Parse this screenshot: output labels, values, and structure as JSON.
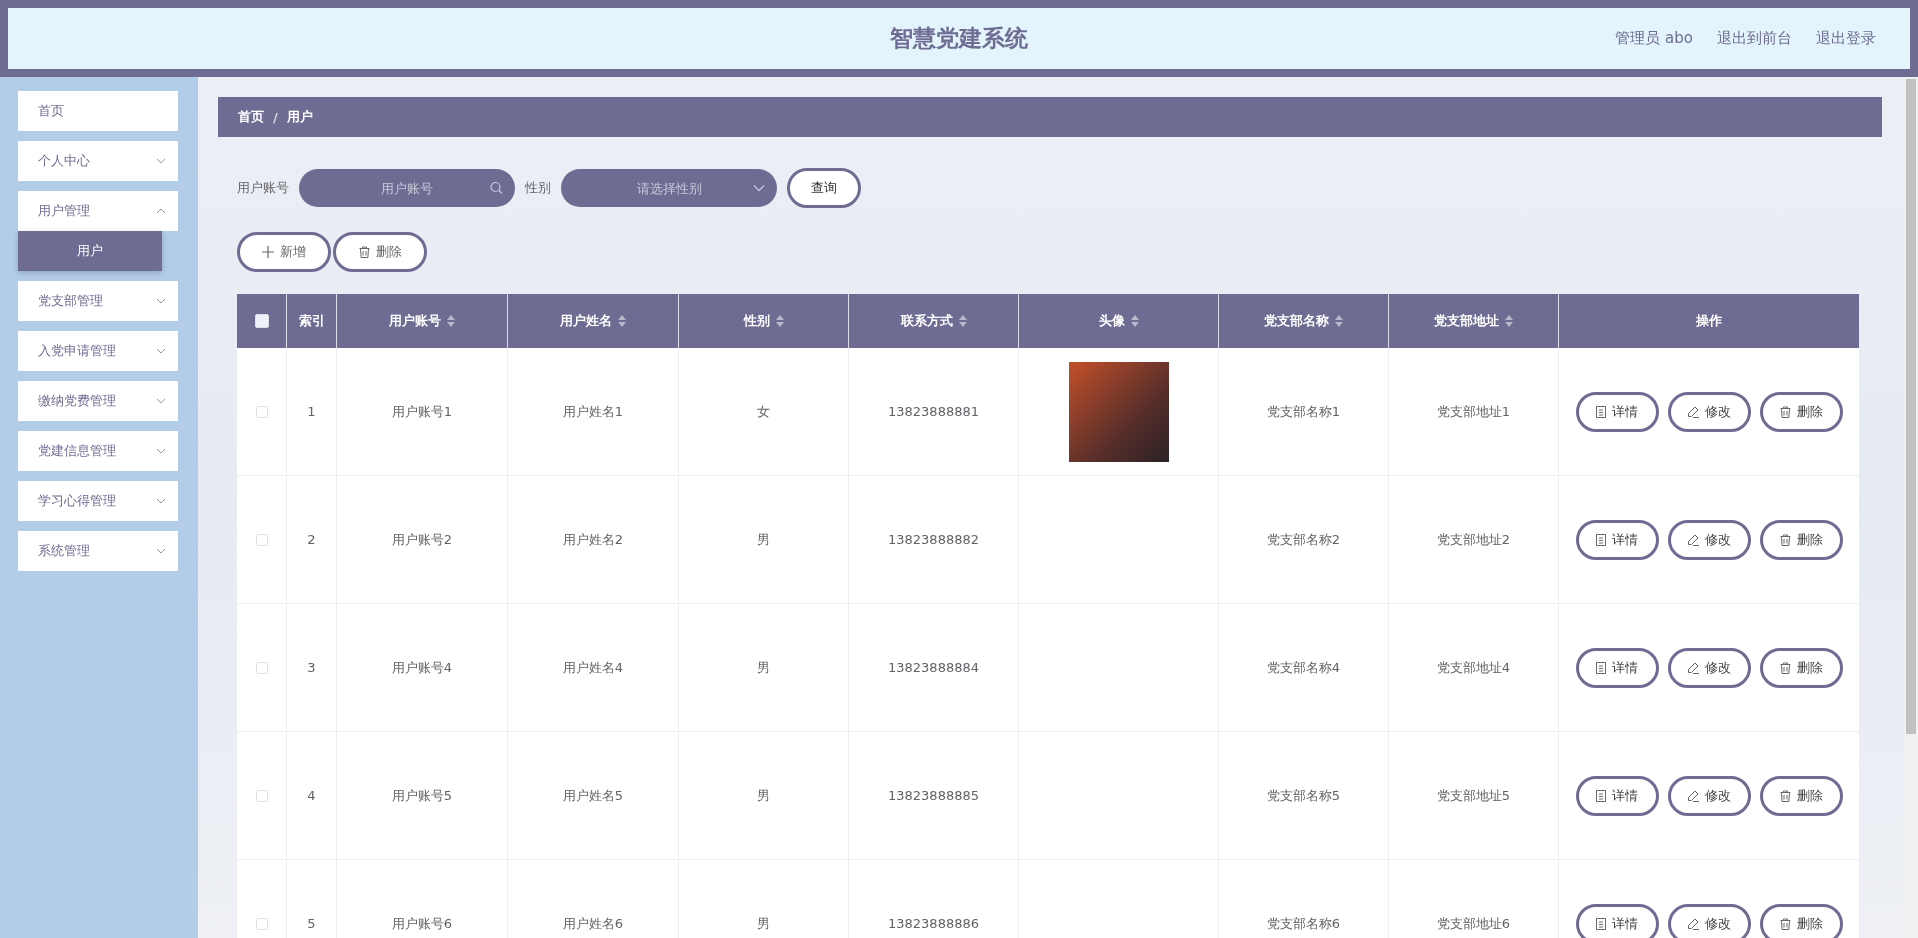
{
  "header": {
    "title": "智慧党建系统",
    "user": "管理员 abo",
    "links": [
      "退出到前台",
      "退出登录"
    ]
  },
  "sidebar": {
    "items": [
      {
        "label": "首页",
        "has_arrow": false
      },
      {
        "label": "个人中心",
        "has_arrow": true,
        "expanded": false
      },
      {
        "label": "用户管理",
        "has_arrow": true,
        "expanded": true,
        "children": [
          {
            "label": "用户",
            "selected": true
          }
        ]
      },
      {
        "label": "党支部管理",
        "has_arrow": true,
        "expanded": false
      },
      {
        "label": "入党申请管理",
        "has_arrow": true,
        "expanded": false
      },
      {
        "label": "缴纳党费管理",
        "has_arrow": true,
        "expanded": false
      },
      {
        "label": "党建信息管理",
        "has_arrow": true,
        "expanded": false
      },
      {
        "label": "学习心得管理",
        "has_arrow": true,
        "expanded": false
      },
      {
        "label": "系统管理",
        "has_arrow": true,
        "expanded": false
      }
    ]
  },
  "breadcrumb": [
    "首页",
    "用户"
  ],
  "breadcrumb_separator": "/",
  "search": {
    "account_label": "用户账号",
    "account_placeholder": "用户账号",
    "gender_label": "性别",
    "gender_placeholder": "请选择性别",
    "query_button": "查询"
  },
  "actions": [
    {
      "kind": "add",
      "label": "新增"
    },
    {
      "kind": "delete",
      "label": "删除"
    }
  ],
  "table": {
    "all_checked": false,
    "columns": [
      {
        "label": "索引",
        "sortable": false
      },
      {
        "label": "用户账号",
        "sortable": true
      },
      {
        "label": "用户姓名",
        "sortable": true
      },
      {
        "label": "性别",
        "sortable": true
      },
      {
        "label": "联系方式",
        "sortable": true
      },
      {
        "label": "头像",
        "sortable": true
      },
      {
        "label": "党支部名称",
        "sortable": true
      },
      {
        "label": "党支部地址",
        "sortable": true
      },
      {
        "label": "操作",
        "sortable": false
      }
    ],
    "rows": [
      {
        "checked": false,
        "index": "1",
        "account": "用户账号1",
        "name": "用户姓名1",
        "gender": "女",
        "phone": "13823888881",
        "has_photo": true,
        "branch": "党支部名称1",
        "address": "党支部地址1",
        "actions": [
          {
            "kind": "detail",
            "label": "详情"
          },
          {
            "kind": "edit",
            "label": "修改"
          },
          {
            "kind": "delete",
            "label": "删除"
          }
        ]
      },
      {
        "checked": false,
        "index": "2",
        "account": "用户账号2",
        "name": "用户姓名2",
        "gender": "男",
        "phone": "13823888882",
        "has_photo": false,
        "branch": "党支部名称2",
        "address": "党支部地址2",
        "actions": [
          {
            "kind": "detail",
            "label": "详情"
          },
          {
            "kind": "edit",
            "label": "修改"
          },
          {
            "kind": "delete",
            "label": "删除"
          }
        ]
      },
      {
        "checked": false,
        "index": "3",
        "account": "用户账号4",
        "name": "用户姓名4",
        "gender": "男",
        "phone": "13823888884",
        "has_photo": false,
        "branch": "党支部名称4",
        "address": "党支部地址4",
        "actions": [
          {
            "kind": "detail",
            "label": "详情"
          },
          {
            "kind": "edit",
            "label": "修改"
          },
          {
            "kind": "delete",
            "label": "删除"
          }
        ]
      },
      {
        "checked": false,
        "index": "4",
        "account": "用户账号5",
        "name": "用户姓名5",
        "gender": "男",
        "phone": "13823888885",
        "has_photo": false,
        "branch": "党支部名称5",
        "address": "党支部地址5",
        "actions": [
          {
            "kind": "detail",
            "label": "详情"
          },
          {
            "kind": "edit",
            "label": "修改"
          },
          {
            "kind": "delete",
            "label": "删除"
          }
        ]
      },
      {
        "checked": false,
        "index": "5",
        "account": "用户账号6",
        "name": "用户姓名6",
        "gender": "男",
        "phone": "13823888886",
        "has_photo": false,
        "branch": "党支部名称6",
        "address": "党支部地址6",
        "actions": [
          {
            "kind": "detail",
            "label": "详情"
          },
          {
            "kind": "edit",
            "label": "修改"
          },
          {
            "kind": "delete",
            "label": "删除"
          }
        ]
      }
    ]
  }
}
